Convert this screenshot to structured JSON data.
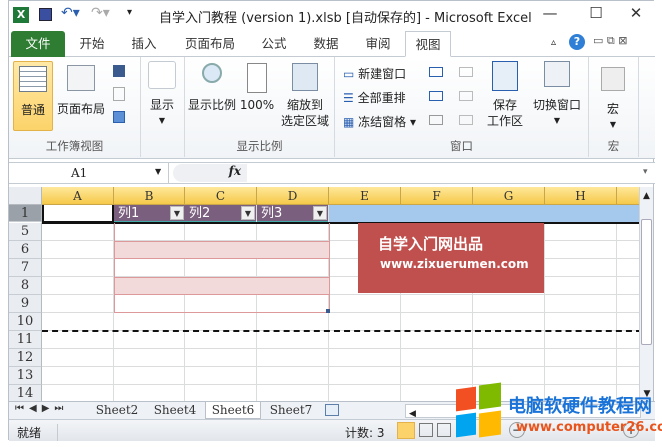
{
  "window": {
    "title": "自学入门教程 (version 1).xlsb [自动保存的]  -  Microsoft Excel",
    "min": "—",
    "max": "☐",
    "close": "✕"
  },
  "tabs": [
    {
      "label": "文件"
    },
    {
      "label": "开始"
    },
    {
      "label": "插入"
    },
    {
      "label": "页面布局"
    },
    {
      "label": "公式"
    },
    {
      "label": "数据"
    },
    {
      "label": "审阅"
    },
    {
      "label": "视图",
      "active": true
    }
  ],
  "ribbon": {
    "workbook_views": {
      "label": "工作簿视图",
      "normal": "普通",
      "page_layout": "页面布局"
    },
    "show": {
      "label": "显示"
    },
    "zoom": {
      "label": "显示比例",
      "zoom": "显示比例",
      "hundred": "100%",
      "zoom_sel_1": "缩放到",
      "zoom_sel_2": "选定区域"
    },
    "window": {
      "label": "窗口",
      "new_window": "新建窗口",
      "arrange_all": "全部重排",
      "freeze": "冻结窗格",
      "save_ws_1": "保存",
      "save_ws_2": "工作区",
      "switch": "切换窗口"
    },
    "macros": {
      "label": "宏",
      "macros": "宏"
    }
  },
  "formula_bar": {
    "name_box": "A1",
    "fx": "fx",
    "value": ""
  },
  "columns": [
    "A",
    "B",
    "C",
    "D",
    "E",
    "F",
    "G",
    "H"
  ],
  "rows": [
    "1",
    "5",
    "6",
    "7",
    "8",
    "9",
    "10",
    "11",
    "12",
    "13",
    "14"
  ],
  "table": {
    "headers": [
      "列1",
      "列2",
      "列3"
    ],
    "header_color": "#7b5f7e",
    "band_color": "#f2d9da"
  },
  "overlay": {
    "line1": "自学入门网出品",
    "line2": "www.zixuerumen.com",
    "color": "#c0504d"
  },
  "sheets": [
    {
      "name": "Sheet2"
    },
    {
      "name": "Sheet4"
    },
    {
      "name": "Sheet6",
      "active": true
    },
    {
      "name": "Sheet7"
    }
  ],
  "status": {
    "ready": "就绪",
    "count": "计数: 3"
  },
  "watermark": {
    "text": "电脑软硬件教程网",
    "url": "www.computer26.com"
  }
}
